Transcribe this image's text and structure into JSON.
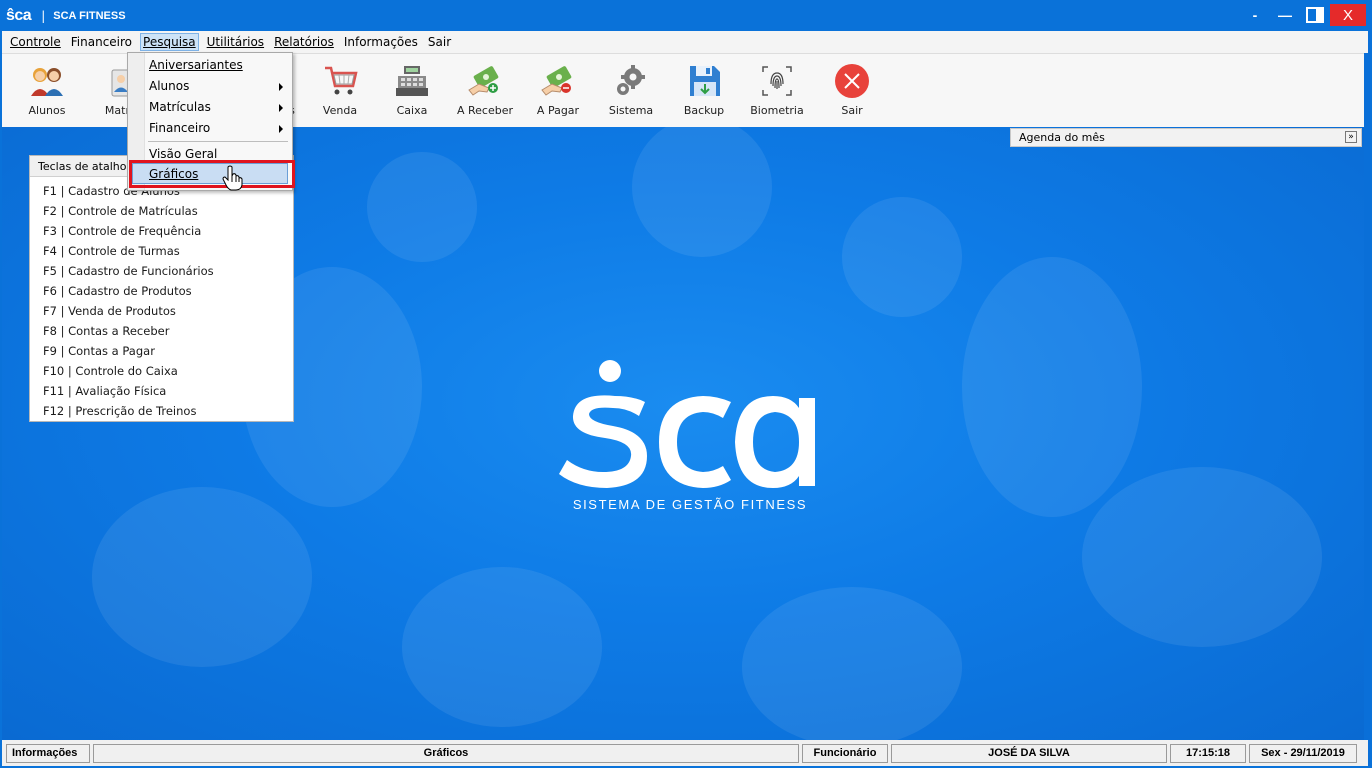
{
  "titlebar": {
    "logo": "ŝca",
    "separator": "|",
    "title": "SCA FITNESS",
    "minimize_label": "-",
    "restore_label": "—",
    "close_label": "X"
  },
  "menubar": {
    "items": [
      {
        "label": "Controle"
      },
      {
        "label": "Financeiro"
      },
      {
        "label": "Pesquisa"
      },
      {
        "label": "Utilitários"
      },
      {
        "label": "Relatórios"
      },
      {
        "label": "Informações"
      },
      {
        "label": "Sair"
      }
    ]
  },
  "toolbar": {
    "items": [
      {
        "label": "Alunos",
        "icon": "students-icon"
      },
      {
        "label": "Matríc",
        "icon": "enrollment-icon"
      },
      {
        "label": "s",
        "icon": "hidden-icon"
      },
      {
        "label": "Venda",
        "icon": "cart-icon"
      },
      {
        "label": "Caixa",
        "icon": "cash-register-icon"
      },
      {
        "label": "A Receber",
        "icon": "receive-money-icon"
      },
      {
        "label": "A Pagar",
        "icon": "pay-money-icon"
      },
      {
        "label": "Sistema",
        "icon": "gear-icon"
      },
      {
        "label": "Backup",
        "icon": "floppy-icon"
      },
      {
        "label": "Biometria",
        "icon": "fingerprint-icon"
      },
      {
        "label": "Sair",
        "icon": "exit-icon"
      }
    ]
  },
  "dropdown": {
    "items": [
      {
        "label": "Aniversariantes"
      },
      {
        "label": "Alunos"
      },
      {
        "label": "Matrículas"
      },
      {
        "label": "Financeiro"
      },
      {
        "label": "Visão Geral"
      },
      {
        "label": "Gráficos"
      }
    ]
  },
  "agenda": {
    "title": "Agenda do mês"
  },
  "shortcuts": {
    "title": "Teclas de atalho",
    "items": [
      "F1 | Cadastro de Alunos",
      "F2 | Controle de Matrículas",
      "F3 | Controle de Frequência",
      "F4 | Controle de Turmas",
      "F5 | Cadastro de Funcionários",
      "F6 | Cadastro de Produtos",
      "F7 | Venda de Produtos",
      "F8 | Contas a Receber",
      "F9 | Contas a Pagar",
      "F10 | Controle do Caixa",
      "F11 | Avaliação Física",
      "F12 | Prescrição de Treinos"
    ]
  },
  "main": {
    "logo_text": "ŝca",
    "tagline": "SISTEMA DE GESTÃO FITNESS"
  },
  "statusbar": {
    "info_label": "Informações",
    "info_value": "Gráficos",
    "role": "Funcionário",
    "user": "JOSÉ DA SILVA",
    "time": "17:15:18",
    "date": "Sex - 29/11/2019"
  },
  "colors": {
    "titlebar": "#0a72d9",
    "background": "#0e7be6",
    "close": "#e52a2a",
    "highlight": "#e0141e"
  }
}
